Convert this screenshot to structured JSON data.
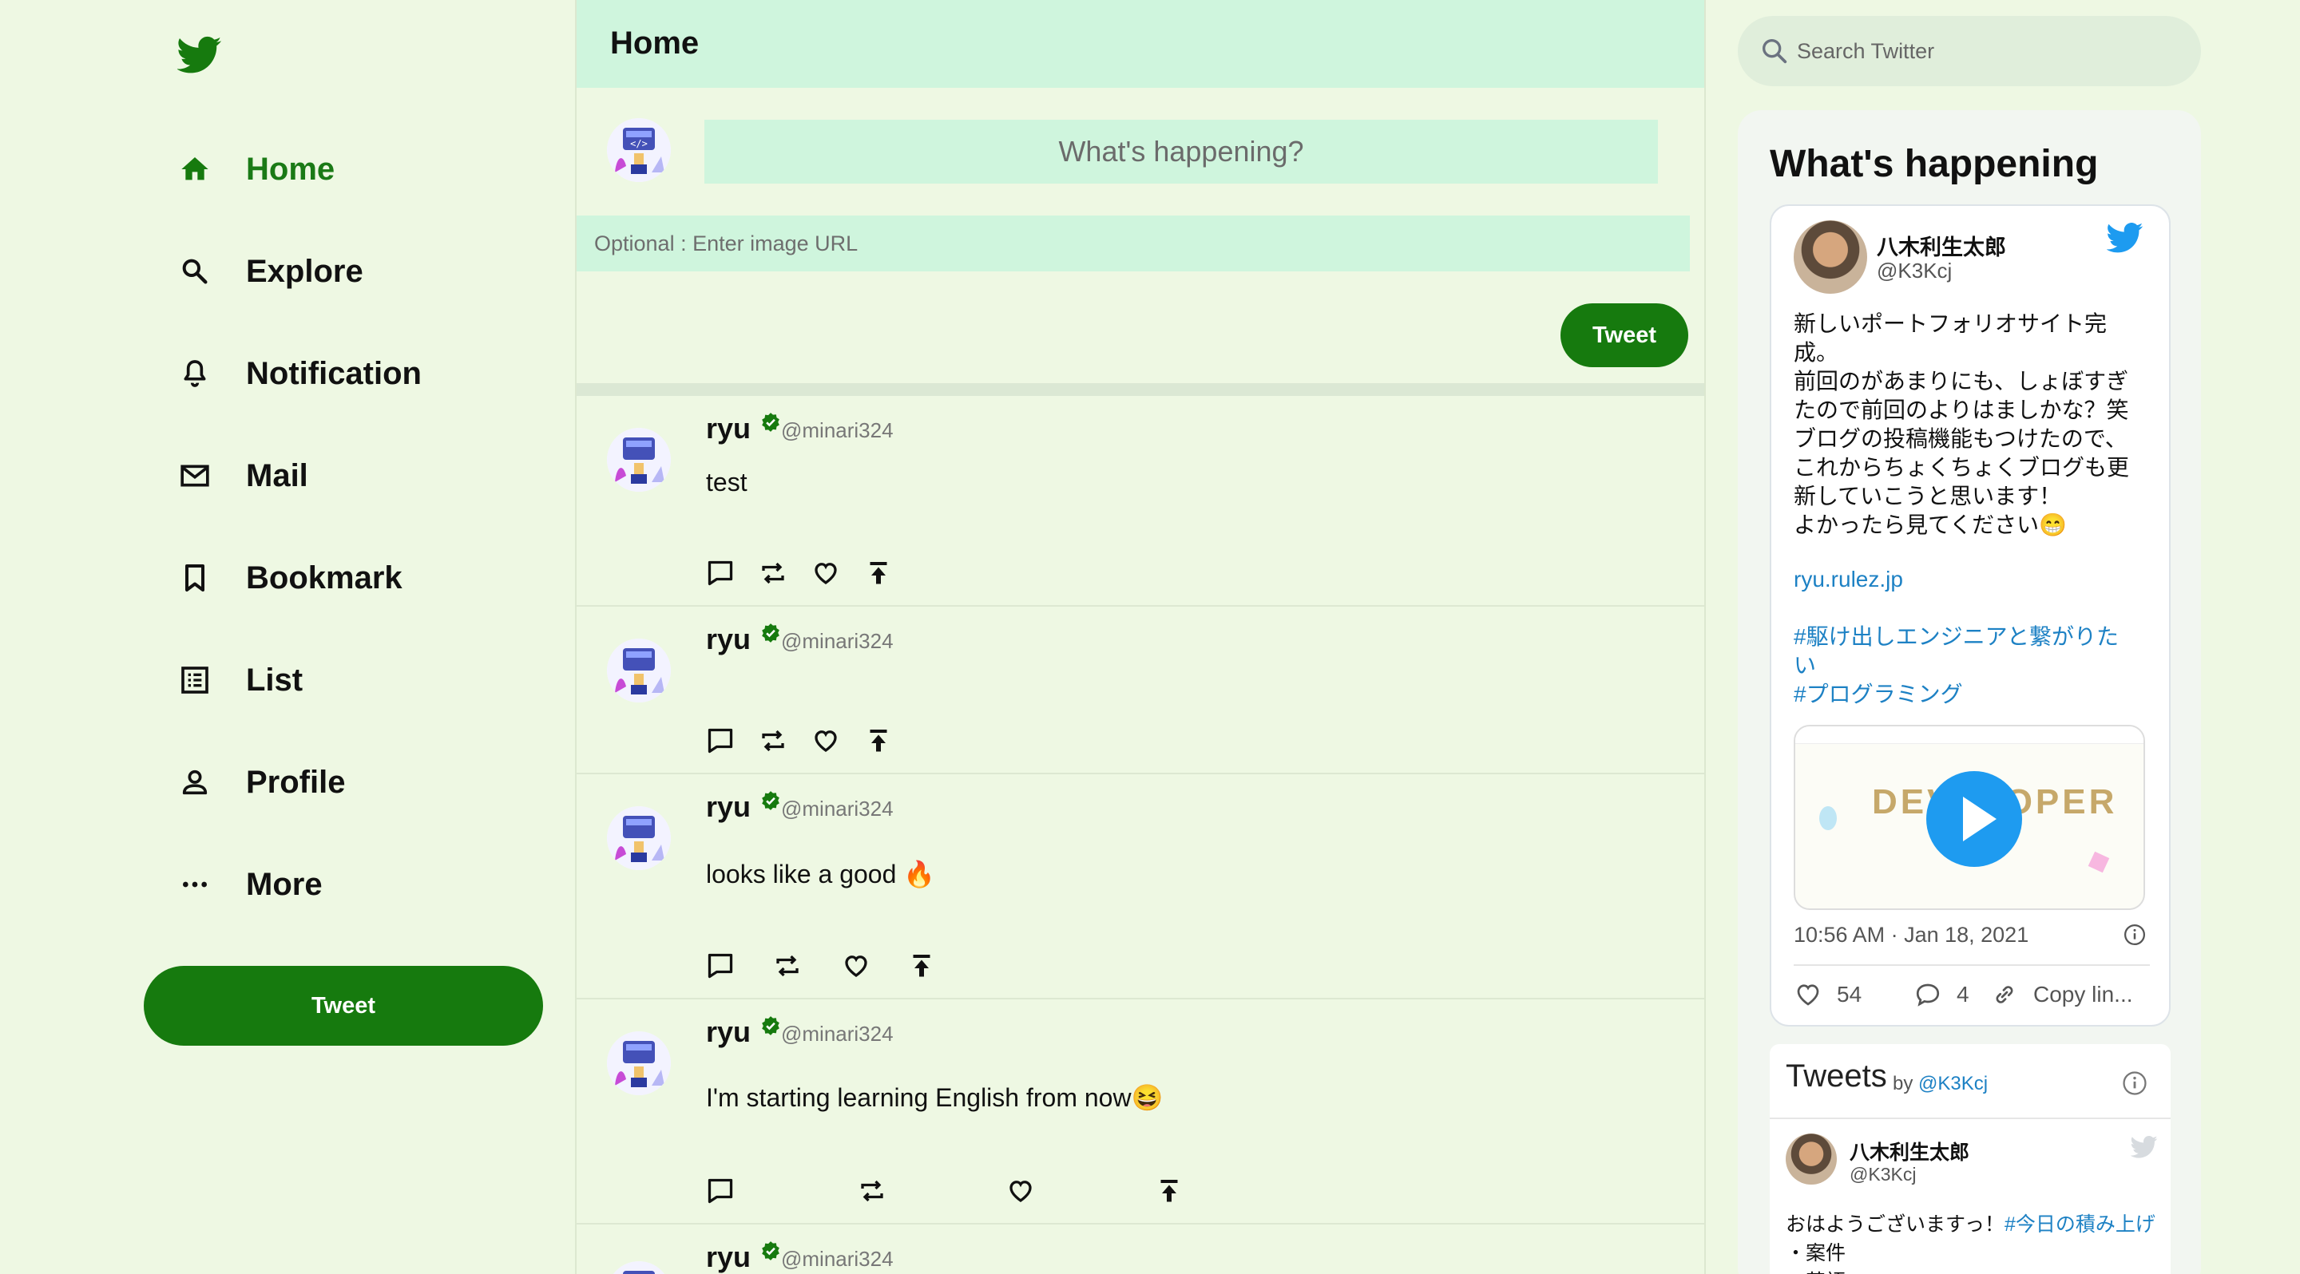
{
  "colors": {
    "accent": "#167a0e",
    "nav_active": "#1a7a16",
    "header_bg": "#cff5dd",
    "page_bg": "#eef8e3",
    "twitter_blue": "#1d9bf0"
  },
  "sidebar": {
    "logo_icon": "twitter-bird-icon",
    "items": [
      {
        "label": "Home",
        "icon": "home-icon",
        "active": true
      },
      {
        "label": "Explore",
        "icon": "search-icon"
      },
      {
        "label": "Notification",
        "icon": "bell-icon"
      },
      {
        "label": "Mail",
        "icon": "mail-icon"
      },
      {
        "label": "Bookmark",
        "icon": "bookmark-icon"
      },
      {
        "label": "List",
        "icon": "list-icon"
      },
      {
        "label": "Profile",
        "icon": "person-icon"
      },
      {
        "label": "More",
        "icon": "more-icon"
      }
    ],
    "tweet_button": "Tweet"
  },
  "main": {
    "title": "Home",
    "compose": {
      "placeholder": "What's happening?",
      "image_placeholder": "Optional : Enter image URL",
      "tweet_button": "Tweet"
    },
    "posts": [
      {
        "name": "ryu",
        "handle": "@minari324",
        "text": "test"
      },
      {
        "name": "ryu",
        "handle": "@minari324",
        "text": ""
      },
      {
        "name": "ryu",
        "handle": "@minari324",
        "text": "looks like a good 🔥"
      },
      {
        "name": "ryu",
        "handle": "@minari324",
        "text": "I'm starting learning English from now😆"
      },
      {
        "name": "ryu",
        "handle": "@minari324",
        "text": ""
      }
    ]
  },
  "right": {
    "search_placeholder": "Search Twitter",
    "trends_title": "What's happening",
    "embed": {
      "name": "八木利生太郎",
      "handle": "@K3Kcj",
      "body": "新しいポートフォリオサイト完\n成。\n前回のがあまりにも、しょぼすぎ\nたので前回のよりはましかな？笑\nブログの投稿機能もつけたので、\nこれからちょくちょくブログも更\n新していこうと思います！\nよかったら見てください😁",
      "link": "ryu.rulez.jp",
      "tags": "#駆け出しエンジニアと繋がりた\nい\n#プログラミング",
      "media_text": "DEVELOPER",
      "time": "10:56 AM · Jan 18, 2021",
      "likes": "54",
      "replies": "4",
      "copy_link": "Copy lin..."
    },
    "timeline": {
      "heading": "Tweets",
      "by_label": "by",
      "by_handle": "@K3Kcj",
      "name": "八木利生太郎",
      "handle": "@K3Kcj",
      "body_prefix": "おはようございますっ！",
      "body_tag": "#今日の積み上げ",
      "body_rest": "・案件\n・英語"
    }
  }
}
